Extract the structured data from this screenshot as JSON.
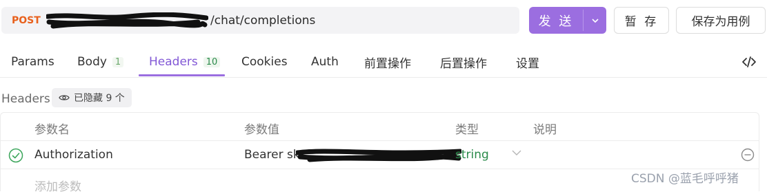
{
  "request": {
    "method": "POST",
    "url_visible": "/chat/completions"
  },
  "actions": {
    "send_label": "发 送",
    "save_label": "暂 存",
    "save_case_label": "保存为用例"
  },
  "tabs": [
    {
      "label": "Params",
      "count": ""
    },
    {
      "label": "Body",
      "count": "1"
    },
    {
      "label": "Headers",
      "count": "10"
    },
    {
      "label": "Cookies",
      "count": ""
    },
    {
      "label": "Auth",
      "count": ""
    },
    {
      "label": "前置操作",
      "count": ""
    },
    {
      "label": "后置操作",
      "count": ""
    },
    {
      "label": "设置",
      "count": ""
    }
  ],
  "headers_section": {
    "title": "Headers",
    "hidden_label": "已隐藏 9 个"
  },
  "table": {
    "columns": [
      "参数名",
      "参数值",
      "类型",
      "说明"
    ],
    "rows": [
      {
        "name": "Authorization",
        "value": "Bearer sk-",
        "type": "string",
        "description": ""
      }
    ],
    "add_placeholder": "添加参数"
  },
  "watermark": "CSDN @蓝毛呼呼猪",
  "colors": {
    "accent": "#9b6ee0",
    "method": "#e8601c",
    "type": "#2a8a4a"
  }
}
